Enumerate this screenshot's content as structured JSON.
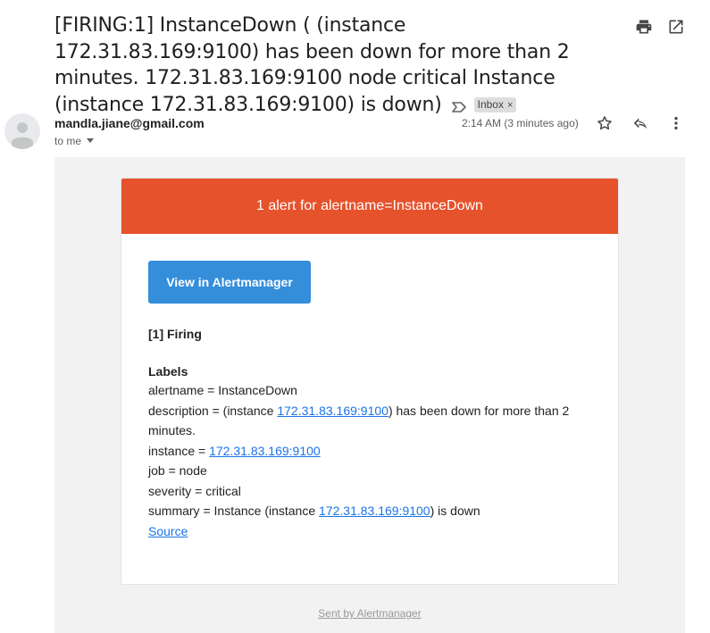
{
  "subject": "[FIRING:1] InstanceDown ( (instance 172.31.83.169:9100) has been down for more than 2 minutes. 172.31.83.169:9100 node critical Instance (instance 172.31.83.169:9100) is down)",
  "inbox_label": "Inbox",
  "inbox_label_remove": "×",
  "sender": "mandla.jiane@gmail.com",
  "to_me": "to me",
  "time": "2:14 AM (3 minutes ago)",
  "icons": {
    "print": "print-icon",
    "open_new": "open-in-new-window-icon",
    "important": "importance-marker-icon",
    "avatar": "default-avatar-icon",
    "star": "star-icon",
    "reply": "reply-icon",
    "more": "more-vertical-icon"
  },
  "email": {
    "header": "1 alert for alertname=InstanceDown",
    "header_color": "#e6522c",
    "button_label": "View in Alertmanager",
    "button_color": "#348eda",
    "firing_title": "[1] Firing",
    "labels_title": "Labels",
    "alertname_line": "alertname = InstanceDown",
    "description_prefix": "description = (instance ",
    "description_link": "172.31.83.169:9100",
    "description_suffix": ") has been down for more than 2 minutes.",
    "instance_prefix": "instance = ",
    "instance_link": "172.31.83.169:9100",
    "job_line": "job = node",
    "severity_line": "severity = critical",
    "summary_prefix": "summary = Instance (instance ",
    "summary_link": "172.31.83.169:9100",
    "summary_suffix": ") is down",
    "source_link": "Source",
    "footer": "Sent by Alertmanager"
  }
}
